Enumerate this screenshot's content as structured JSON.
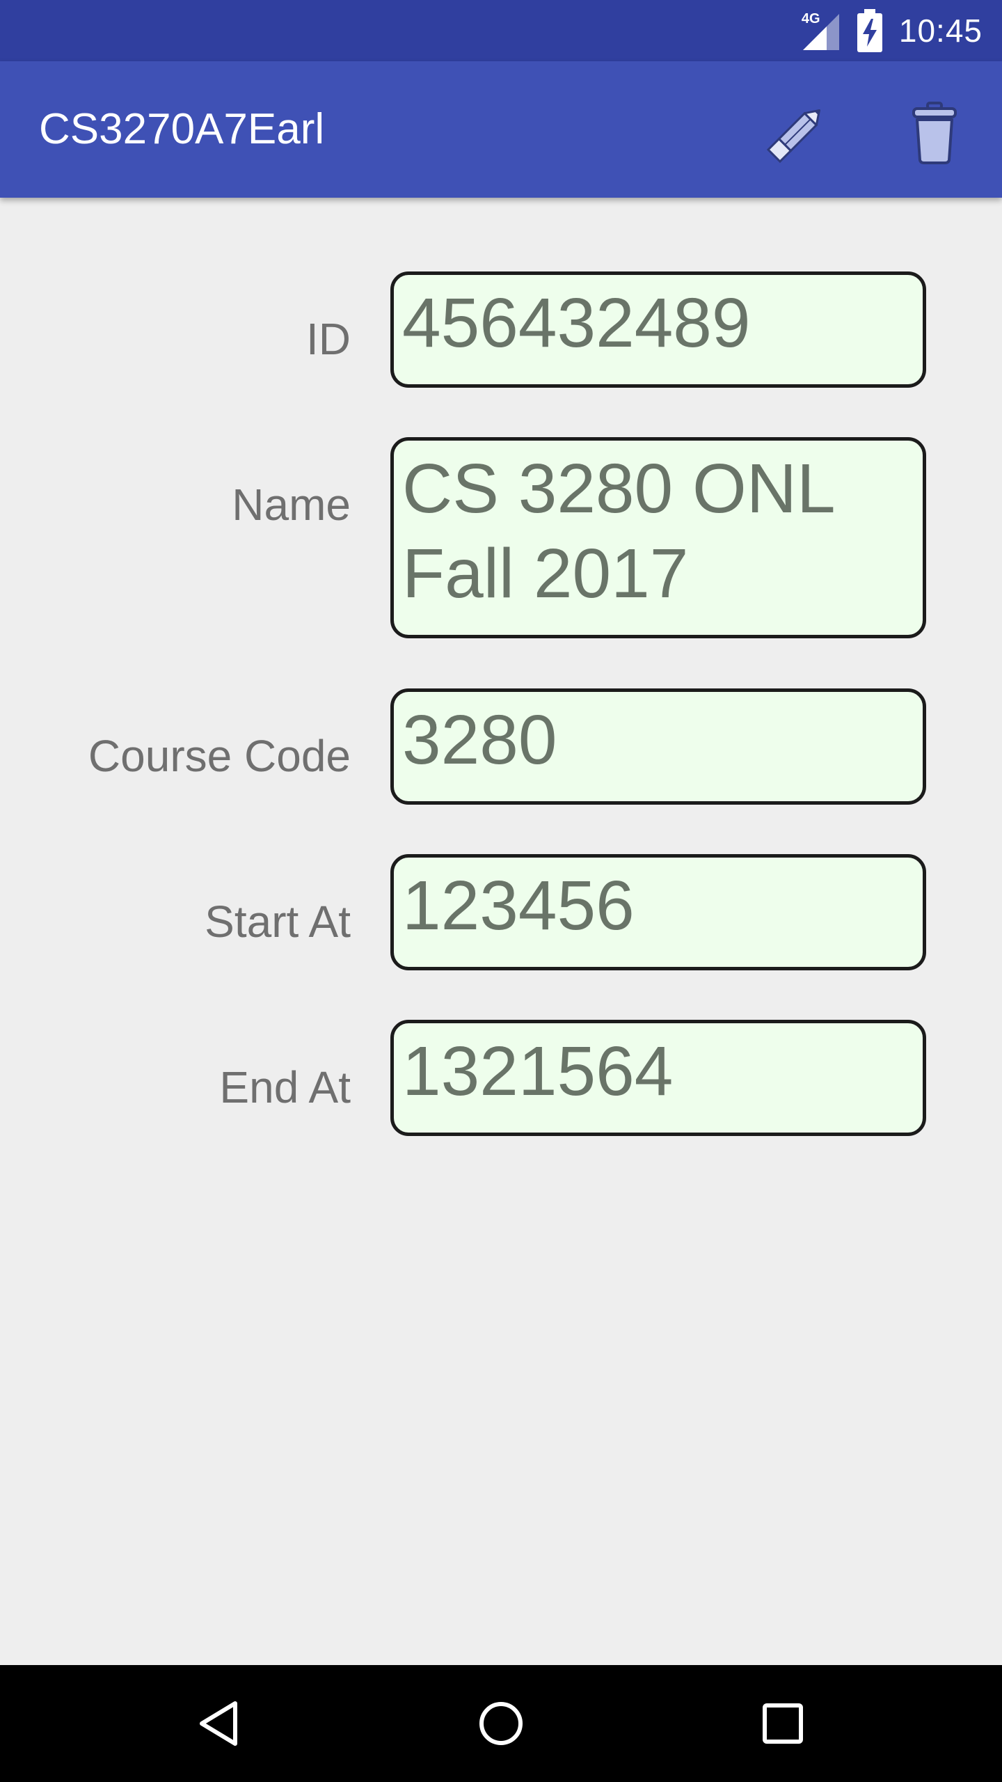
{
  "status_bar": {
    "network_type": "4G",
    "time": "10:45",
    "icons": [
      "signal-icon",
      "battery-charging-icon"
    ]
  },
  "app_bar": {
    "title": "CS3270A7Earl",
    "actions": [
      {
        "name": "edit",
        "icon": "pencil-icon"
      },
      {
        "name": "delete",
        "icon": "trash-icon"
      }
    ]
  },
  "form": {
    "id": {
      "label": "ID",
      "value": "456432489"
    },
    "name": {
      "label": "Name",
      "value": "CS 3280 ONL Fall 2017"
    },
    "course_code": {
      "label": "Course Code",
      "value": "3280"
    },
    "start_at": {
      "label": "Start At",
      "value": "123456"
    },
    "end_at": {
      "label": "End At",
      "value": "1321564"
    }
  },
  "nav_bar": {
    "icons": [
      "back-icon",
      "home-icon",
      "recents-icon"
    ]
  },
  "colors": {
    "status_bar": "#303f9f",
    "app_bar": "#3f51b5",
    "background": "#eeeeee",
    "field_background": "#eefeec",
    "field_border": "#1b1b1b",
    "field_text": "#697468",
    "label_text": "#6f6f6f",
    "nav_bar": "#000000"
  }
}
